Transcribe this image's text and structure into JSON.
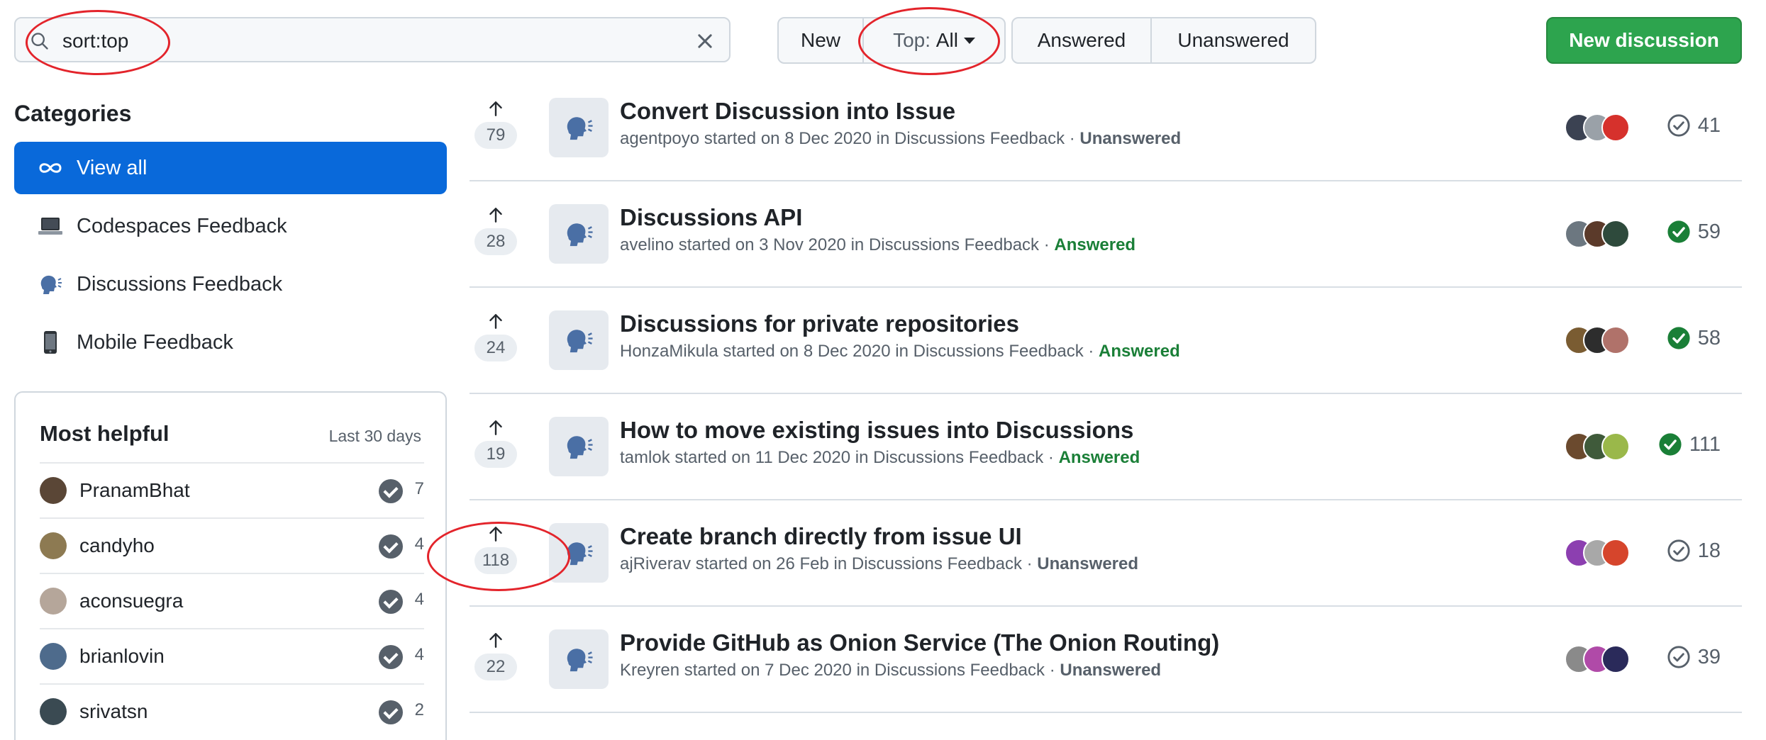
{
  "search": {
    "value": "sort:top"
  },
  "sort": {
    "new_label": "New",
    "top_prefix": "Top:",
    "top_value": "All"
  },
  "filter": {
    "answered_label": "Answered",
    "unanswered_label": "Unanswered"
  },
  "new_discussion_label": "New discussion",
  "colors": {
    "accent": "#0969da",
    "primary_button": "#2da44e",
    "answered": "#1a7f37",
    "annotation": "#e3242b"
  },
  "sidebar": {
    "categories_title": "Categories",
    "items": [
      {
        "label": "View all",
        "icon": "infinity-icon",
        "active": true
      },
      {
        "label": "Codespaces Feedback",
        "icon": "laptop-icon",
        "active": false
      },
      {
        "label": "Discussions Feedback",
        "icon": "speaking-head-icon",
        "active": false
      },
      {
        "label": "Mobile Feedback",
        "icon": "mobile-phone-icon",
        "active": false
      }
    ],
    "most_helpful": {
      "title": "Most helpful",
      "range": "Last 30 days",
      "users": [
        {
          "name": "PranamBhat",
          "count": "7",
          "avatar_color": "#5a4636"
        },
        {
          "name": "candyho",
          "count": "4",
          "avatar_color": "#8d7a52"
        },
        {
          "name": "aconsuegra",
          "count": "4",
          "avatar_color": "#b5a69a"
        },
        {
          "name": "brianlovin",
          "count": "4",
          "avatar_color": "#4e6b8c"
        },
        {
          "name": "srivatsn",
          "count": "2",
          "avatar_color": "#3a4a52"
        }
      ]
    }
  },
  "discussions": [
    {
      "votes": "79",
      "title": "Convert Discussion into Issue",
      "user": "agentpoyo",
      "started": "started on",
      "date": "8 Dec 2020",
      "in": "in",
      "category": "Discussions Feedback",
      "status": "Unanswered",
      "answered": false,
      "comments": "41",
      "avatars": [
        "#3b4252",
        "#9aa1a8",
        "#d6312c"
      ]
    },
    {
      "votes": "28",
      "title": "Discussions API",
      "user": "avelino",
      "started": "started on",
      "date": "3 Nov 2020",
      "in": "in",
      "category": "Discussions Feedback",
      "status": "Answered",
      "answered": true,
      "comments": "59",
      "avatars": [
        "#6c7780",
        "#5b3a2a",
        "#2e4a3c"
      ]
    },
    {
      "votes": "24",
      "title": "Discussions for private repositories",
      "user": "HonzaMikula",
      "started": "started on",
      "date": "8 Dec 2020",
      "in": "in",
      "category": "Discussions Feedback",
      "status": "Answered",
      "answered": true,
      "comments": "58",
      "avatars": [
        "#7a5c32",
        "#2d2d2d",
        "#b0726a"
      ]
    },
    {
      "votes": "19",
      "title": "How to move existing issues into Discussions",
      "user": "tamlok",
      "started": "started on",
      "date": "11 Dec 2020",
      "in": "in",
      "category": "Discussions Feedback",
      "status": "Answered",
      "answered": true,
      "comments": "111",
      "avatars": [
        "#6b4a2e",
        "#3f5a3a",
        "#9ab84a"
      ]
    },
    {
      "votes": "118",
      "title": "Create branch directly from issue UI",
      "user": "ajRiverav",
      "started": "started on",
      "date": "26 Feb",
      "in": "in",
      "category": "Discussions Feedback",
      "status": "Unanswered",
      "answered": false,
      "comments": "18",
      "avatars": [
        "#8c3fb0",
        "#a8a8a8",
        "#d6452c"
      ]
    },
    {
      "votes": "22",
      "title": "Provide GitHub as Onion Service (The Onion Routing)",
      "user": "Kreyren",
      "started": "started on",
      "date": "7 Dec 2020",
      "in": "in",
      "category": "Discussions Feedback",
      "status": "Unanswered",
      "answered": false,
      "comments": "39",
      "avatars": [
        "#8a8a8a",
        "#b04aa8",
        "#2a2a5a"
      ]
    }
  ]
}
